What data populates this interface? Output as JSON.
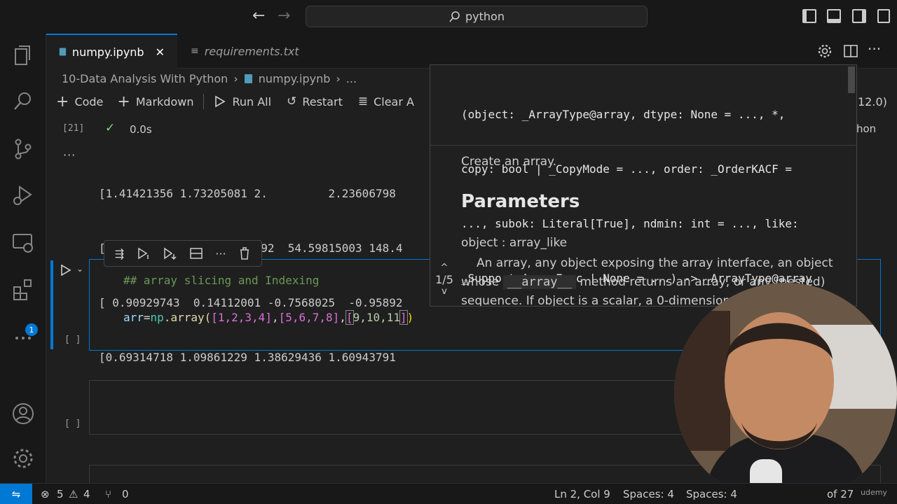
{
  "titlebar": {
    "back": "←",
    "forward": "→",
    "search_text": "python"
  },
  "tabs": [
    {
      "label": "numpy.ipynb",
      "close": "✕"
    },
    {
      "label": "requirements.txt"
    }
  ],
  "breadcrumb": [
    "10-Data Analysis With Python",
    "numpy.ipynb",
    "..."
  ],
  "toolbar": {
    "code": "Code",
    "markdown": "Markdown",
    "run_all": "Run All",
    "restart": "Restart",
    "clear": "Clear A"
  },
  "kernel_fragment": "12.0)",
  "kernel_fragment2": "hon",
  "prev_cell": {
    "exec_count": "[21]",
    "status_time": "0.0s",
    "output_lines": [
      "[1.41421356 1.73205081 2.         2.23606798",
      "[  7.3890561   20.08553692  54.59815003 148.4",
      "[ 0.90929743  0.14112001 -0.7568025  -0.95892",
      "[0.69314718 1.09861229 1.38629436 1.60943791"
    ]
  },
  "active_cell": {
    "exec_count": "[ ]",
    "comment": "## array slicing and Indexing",
    "code": {
      "var": "arr",
      "eq": "=",
      "mod": "np",
      "fn": ".array(",
      "a1": "[1,2,3,4]",
      "c1": ",",
      "a2": "[5,6,7,8]",
      "c2": ",",
      "a3_open": "[",
      "a3_body": "9,10,11",
      "cursor": "]",
      "close": ")"
    }
  },
  "empty_cell": {
    "exec_count": "[ ]"
  },
  "hover": {
    "signature": [
      "(object: _ArrayType@array, dtype: None = ..., *,",
      "copy: bool | _CopyMode = ..., order: _OrderKACF =",
      "..., subok: Literal[True], ndmin: int = ..., like:",
      "_SupportsArrayFunc | None = ...) -> _ArrayType@array"
    ],
    "summary": "Create an array.",
    "params_heading": "Parameters",
    "param_name": "object : array_like",
    "param_desc_pre": "An array, any object exposing the array interface, an object whose",
    "param_desc_code": "__array__",
    "param_desc_post": "method returns an array, or any (nested) sequence. If object is a scalar, a 0-dimensional",
    "nav_up": "^",
    "nav_count": "1/5",
    "nav_down": "v"
  },
  "statusbar": {
    "errors": "5",
    "warnings": "4",
    "ports": "0",
    "position": "Ln 2, Col 9",
    "spaces1": "Spaces: 4",
    "spaces2": "Spaces: 4",
    "page": "of 27",
    "watermark": "udemy"
  },
  "activity_badge": "1",
  "colors": {
    "accent": "#0078d4",
    "code_var": "#9cdcfe",
    "code_fn": "#dcdcaa",
    "code_num": "#b5cea8",
    "comment": "#6a9955",
    "bracket": "#da70d6"
  }
}
